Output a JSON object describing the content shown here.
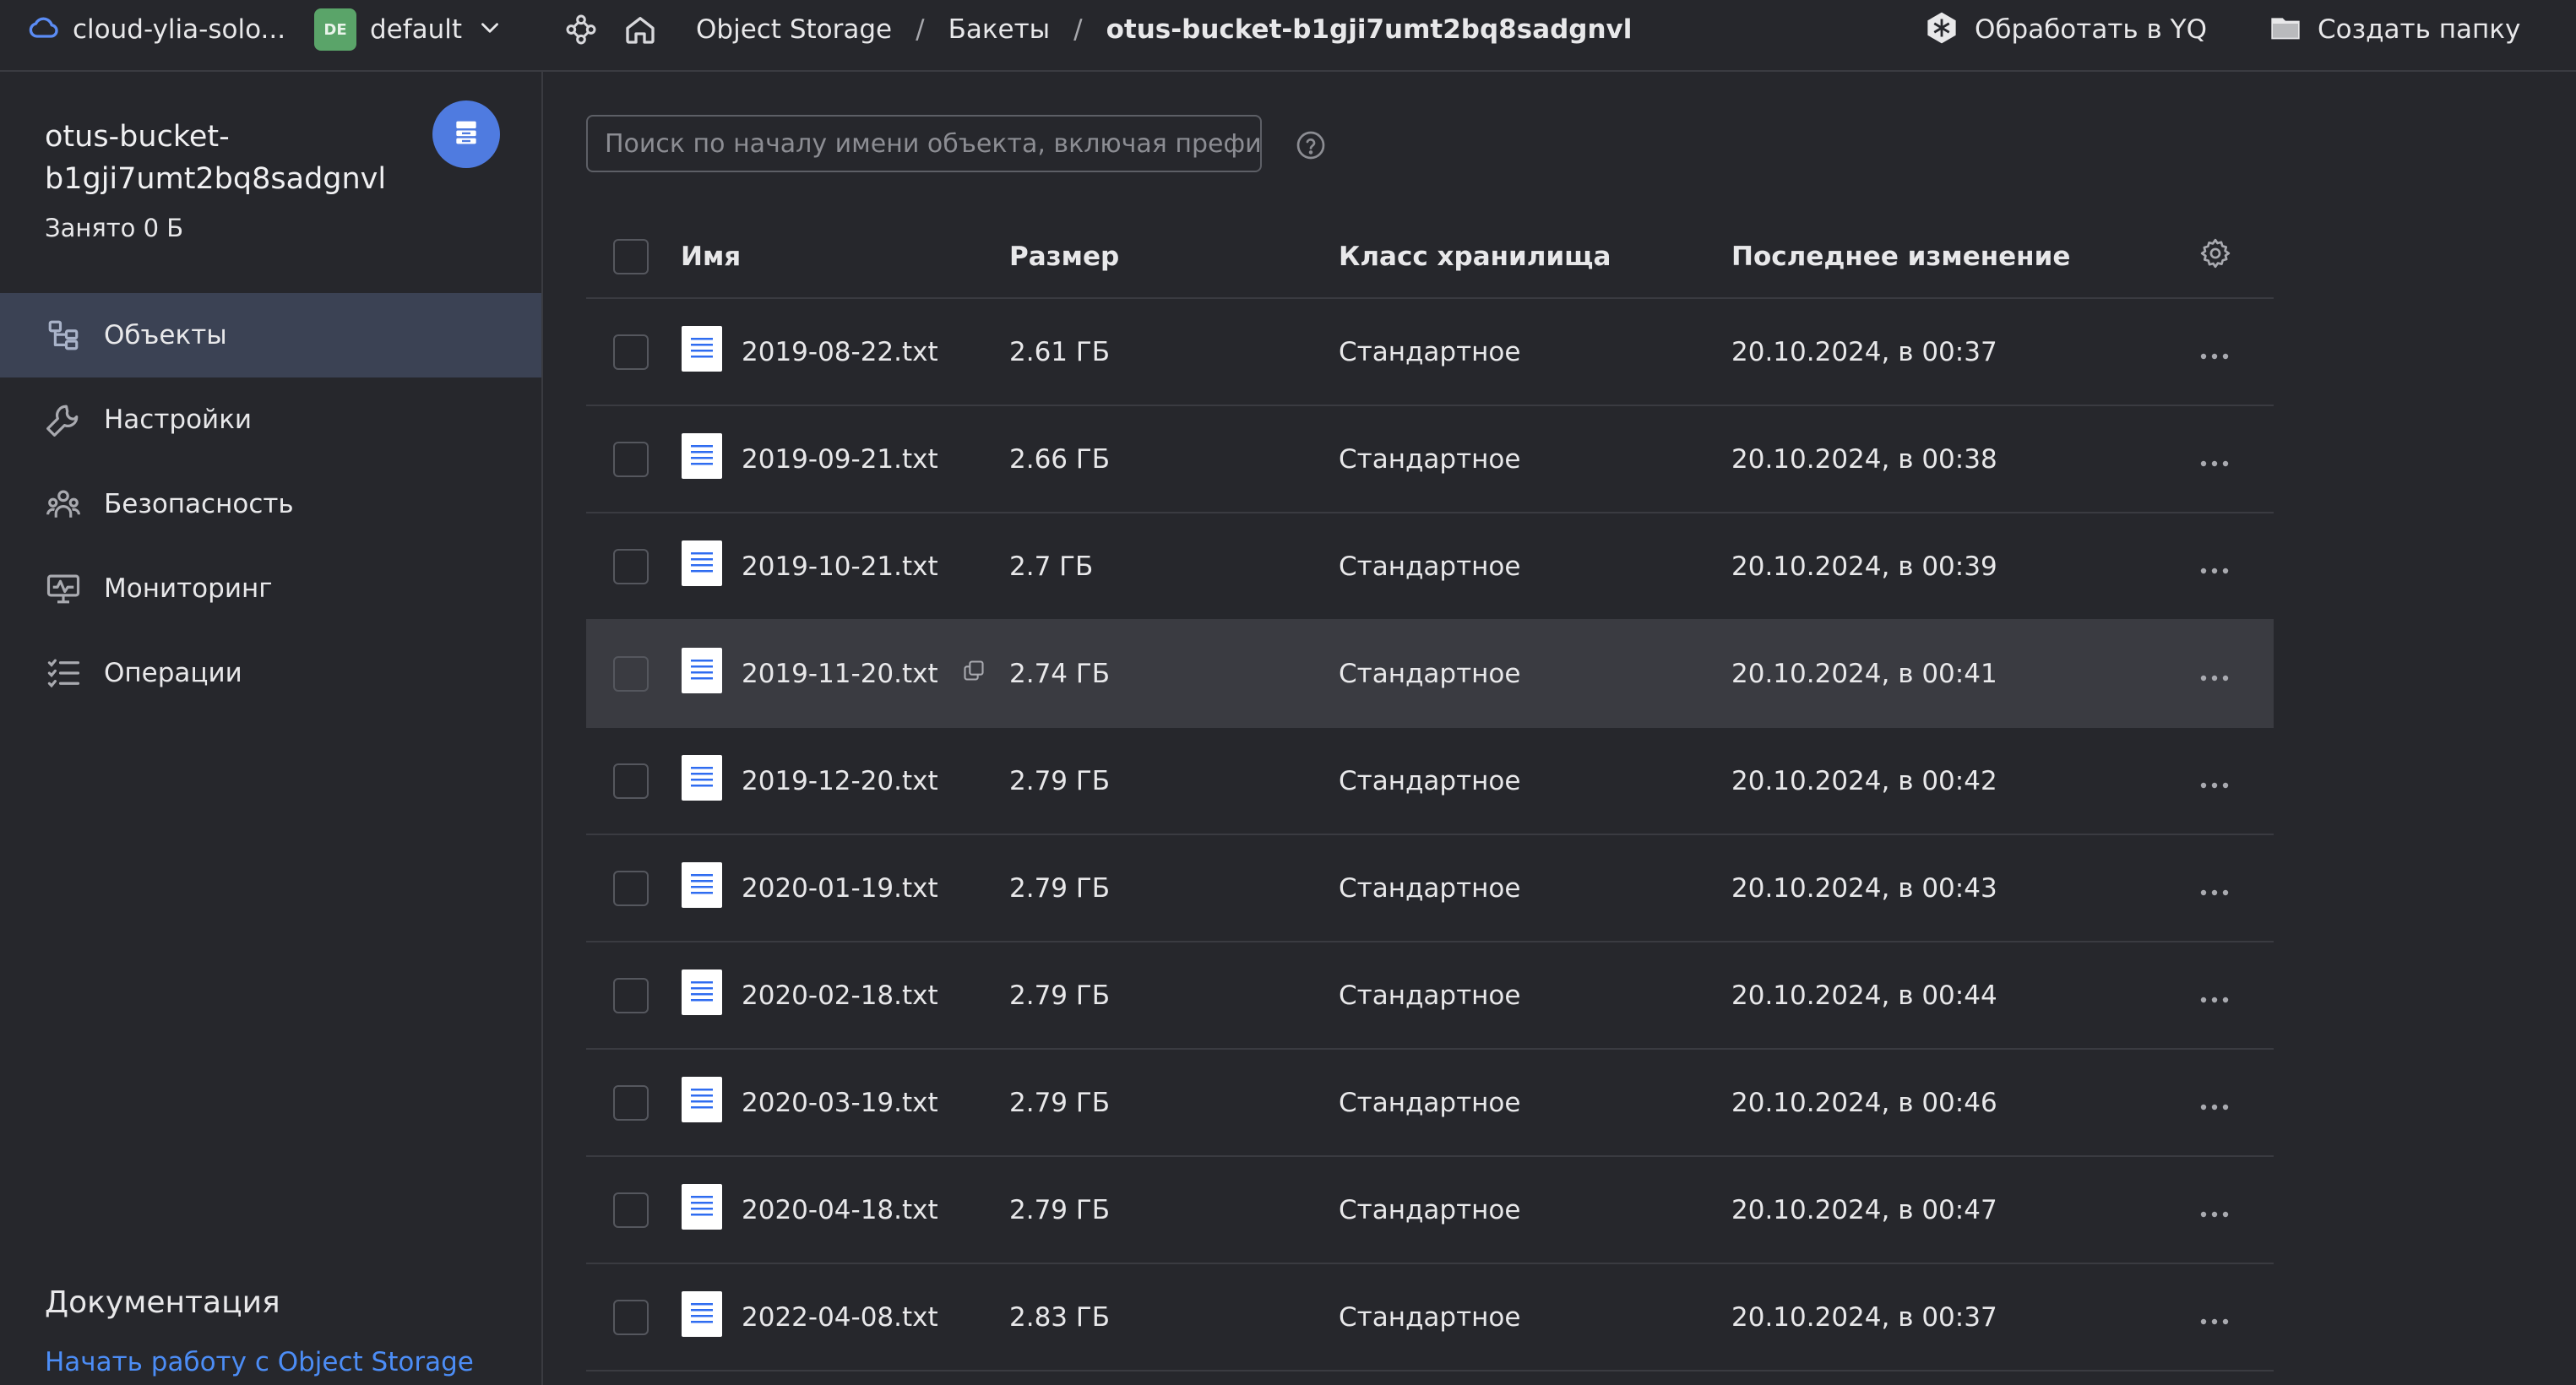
{
  "topbar": {
    "cloud_name": "cloud-ylia-solo...",
    "folder_badge": "DE",
    "folder_name": "default",
    "breadcrumbs": [
      "Object Storage",
      "Бакеты",
      "otus-bucket-b1gji7umt2bq8sadgnvl"
    ],
    "yq_label": "Обработать в YQ",
    "mkdir_label": "Создать папку"
  },
  "sidebar": {
    "bucket_name": "otus-bucket-b1gji7umt2bq8sadgnvl",
    "used": "Занято 0 Б",
    "items": [
      {
        "label": "Объекты",
        "icon": "objects-icon",
        "active": true
      },
      {
        "label": "Настройки",
        "icon": "wrench-icon",
        "active": false
      },
      {
        "label": "Безопасность",
        "icon": "users-icon",
        "active": false
      },
      {
        "label": "Мониторинг",
        "icon": "monitor-icon",
        "active": false
      },
      {
        "label": "Операции",
        "icon": "list-icon",
        "active": false
      }
    ],
    "docs_title": "Документация",
    "docs_link": "Начать работу с Object Storage"
  },
  "search": {
    "placeholder": "Поиск по началу имени объекта, включая префикс"
  },
  "table": {
    "headers": {
      "name": "Имя",
      "size": "Размер",
      "class": "Класс хранилища",
      "modified": "Последнее изменение"
    },
    "rows": [
      {
        "name": "2019-08-22.txt",
        "size": "2.61 ГБ",
        "class": "Стандартное",
        "modified": "20.10.2024, в 00:37"
      },
      {
        "name": "2019-09-21.txt",
        "size": "2.66 ГБ",
        "class": "Стандартное",
        "modified": "20.10.2024, в 00:38"
      },
      {
        "name": "2019-10-21.txt",
        "size": "2.7 ГБ",
        "class": "Стандартное",
        "modified": "20.10.2024, в 00:39"
      },
      {
        "name": "2019-11-20.txt",
        "size": "2.74 ГБ",
        "class": "Стандартное",
        "modified": "20.10.2024, в 00:41"
      },
      {
        "name": "2019-12-20.txt",
        "size": "2.79 ГБ",
        "class": "Стандартное",
        "modified": "20.10.2024, в 00:42"
      },
      {
        "name": "2020-01-19.txt",
        "size": "2.79 ГБ",
        "class": "Стандартное",
        "modified": "20.10.2024, в 00:43"
      },
      {
        "name": "2020-02-18.txt",
        "size": "2.79 ГБ",
        "class": "Стандартное",
        "modified": "20.10.2024, в 00:44"
      },
      {
        "name": "2020-03-19.txt",
        "size": "2.79 ГБ",
        "class": "Стандартное",
        "modified": "20.10.2024, в 00:46"
      },
      {
        "name": "2020-04-18.txt",
        "size": "2.79 ГБ",
        "class": "Стандартное",
        "modified": "20.10.2024, в 00:47"
      },
      {
        "name": "2022-04-08.txt",
        "size": "2.83 ГБ",
        "class": "Стандартное",
        "modified": "20.10.2024, в 00:37"
      }
    ]
  },
  "colors": {
    "background": "#26272c",
    "active_nav": "#3b4254",
    "accent": "#4f7be0",
    "link": "#4c8df6",
    "folder_badge": "#5aa469"
  }
}
